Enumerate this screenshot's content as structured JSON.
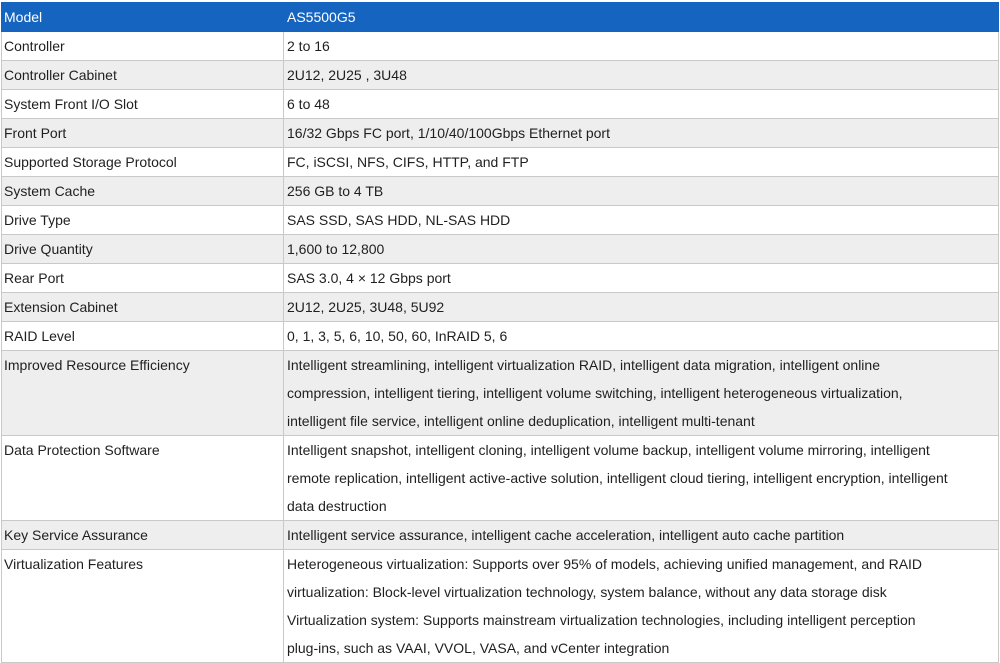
{
  "table": {
    "header": {
      "label": "Model",
      "value": "AS5500G5"
    },
    "rows": [
      {
        "label": "Controller",
        "lines": [
          "2 to 16"
        ]
      },
      {
        "label": "Controller Cabinet",
        "lines": [
          "2U12, 2U25 , 3U48"
        ]
      },
      {
        "label": "System Front I/O Slot",
        "lines": [
          "6 to 48"
        ]
      },
      {
        "label": "Front Port",
        "lines": [
          "16/32 Gbps FC port, 1/10/40/100Gbps Ethernet port"
        ]
      },
      {
        "label": "Supported Storage Protocol",
        "lines": [
          "FC, iSCSI, NFS, CIFS, HTTP, and FTP"
        ]
      },
      {
        "label": "System Cache",
        "lines": [
          "256 GB to 4 TB"
        ]
      },
      {
        "label": "Drive Type",
        "lines": [
          "SAS SSD, SAS HDD, NL-SAS HDD"
        ]
      },
      {
        "label": "Drive Quantity",
        "lines": [
          "1,600 to 12,800"
        ]
      },
      {
        "label": "Rear Port",
        "lines": [
          "SAS 3.0, 4 × 12 Gbps port"
        ]
      },
      {
        "label": "Extension Cabinet",
        "lines": [
          "2U12, 2U25, 3U48, 5U92"
        ]
      },
      {
        "label": "RAID Level",
        "lines": [
          "0, 1, 3, 5, 6, 10, 50, 60, InRAID 5, 6"
        ]
      },
      {
        "label": "Improved Resource Efficiency",
        "lines": [
          "Intelligent streamlining, intelligent virtualization RAID, intelligent data migration, intelligent online",
          "compression, intelligent tiering, intelligent volume switching, intelligent heterogeneous virtualization,",
          "intelligent file service, intelligent online deduplication, intelligent multi-tenant"
        ]
      },
      {
        "label": "Data Protection Software",
        "lines": [
          "Intelligent snapshot, intelligent cloning, intelligent volume backup, intelligent volume mirroring, intelligent",
          "remote replication, intelligent active-active solution, intelligent cloud tiering, intelligent encryption, intelligent",
          "data destruction"
        ]
      },
      {
        "label": "Key Service Assurance",
        "lines": [
          "Intelligent service assurance, intelligent cache acceleration, intelligent auto cache partition"
        ]
      },
      {
        "label": "Virtualization Features",
        "lines": [
          "Heterogeneous virtualization: Supports over 95% of models, achieving unified management, and RAID",
          "virtualization: Block-level virtualization technology, system balance, without any data storage disk",
          "Virtualization system: Supports mainstream virtualization technologies, including intelligent perception",
          "plug-ins, such as VAAI, VVOL, VASA, and vCenter integration"
        ]
      }
    ]
  }
}
